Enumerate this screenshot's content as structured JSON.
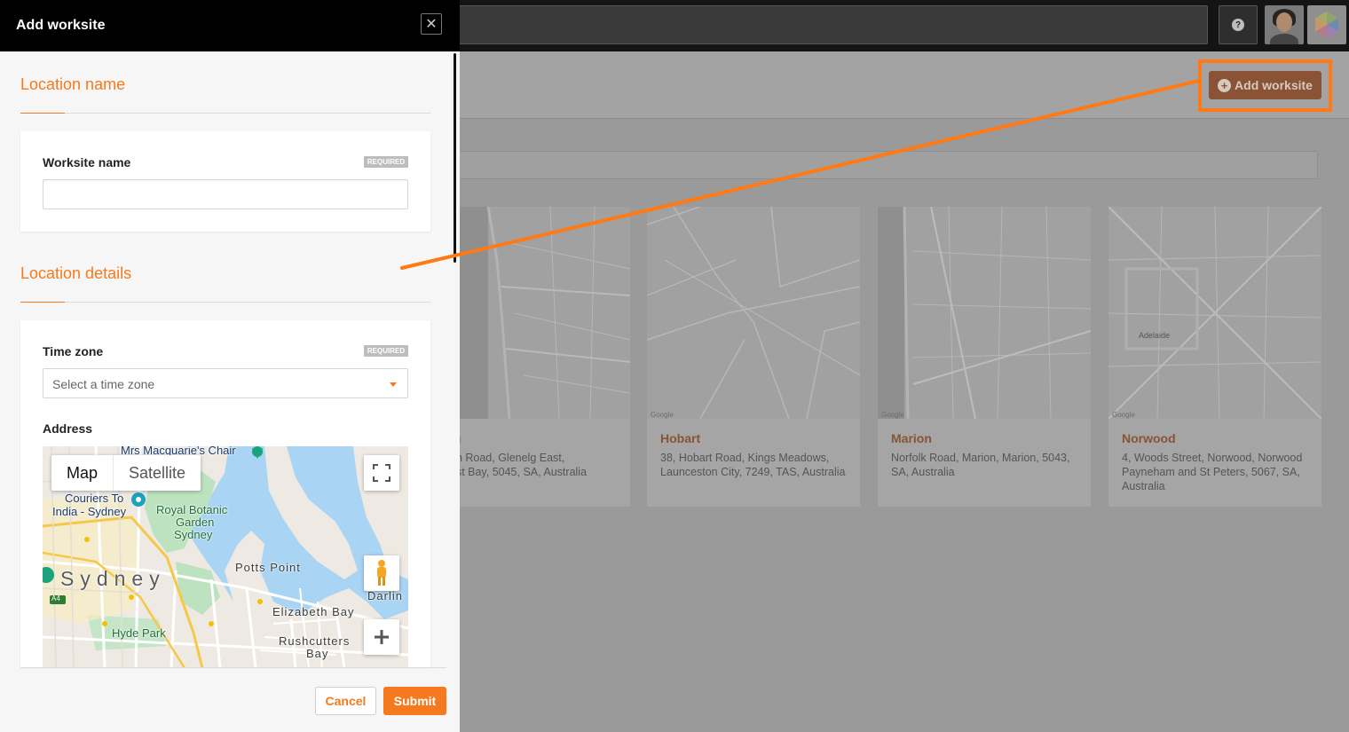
{
  "app": {
    "help_icon_glyph": "?",
    "add_worksite_label": "Add worksite",
    "add_worksite_plus": "+"
  },
  "worksites": [
    {
      "title": "Glenelg",
      "visible_title": "lg",
      "address": "Anzac Highway, Glenelg, Glenelg East, Glenelg",
      "visible_address": "on Road, Glenelg East,\nast Bay, 5045, SA, Australia"
    },
    {
      "title": "Hobart",
      "address": "38, Hobart Road, Kings Meadows, Launceston City, 7249, TAS, Australia"
    },
    {
      "title": "Marion",
      "address": "Norfolk Road, Marion, Marion, 5043, SA, Australia"
    },
    {
      "title": "Norwood",
      "address": "4, Woods Street, Norwood, Norwood Payneham and St Peters, 5067, SA, Australia"
    }
  ],
  "card_map_labels": {
    "norwood": "Adelaide",
    "google": "Google"
  },
  "drawer": {
    "title": "Add worksite",
    "close_glyph": "✕",
    "section_location_name": "Location name",
    "section_location_details": "Location details",
    "worksite_name_label": "Worksite name",
    "worksite_name_value": "",
    "worksite_name_placeholder": "",
    "required_badge": "REQUIRED",
    "time_zone_label": "Time zone",
    "time_zone_placeholder": "Select a time zone",
    "address_label": "Address",
    "cancel_label": "Cancel",
    "submit_label": "Submit"
  },
  "map": {
    "tab_map": "Map",
    "tab_satellite": "Satellite",
    "labels": {
      "mrs_macquarie": "Mrs Macquarie's Chair",
      "couriers_line1": "Couriers To",
      "couriers_line2": "India - Sydney",
      "royal_line1": "Royal Botanic",
      "royal_line2": "Garden",
      "royal_line3": "Sydney",
      "potts_point": "Potts Point",
      "sydney": "Sydney",
      "darling": "Darlin",
      "elizabeth_bay": "Elizabeth Bay",
      "hyde_park": "Hyde Park",
      "rushcutters_line1": "Rushcutters",
      "rushcutters_line2": "Bay",
      "road_a4": "A4"
    }
  },
  "colors": {
    "accent": "#f57a1c",
    "annotation": "#ff7a14",
    "header_bg": "#000000",
    "map_water": "#a9d4f3"
  }
}
